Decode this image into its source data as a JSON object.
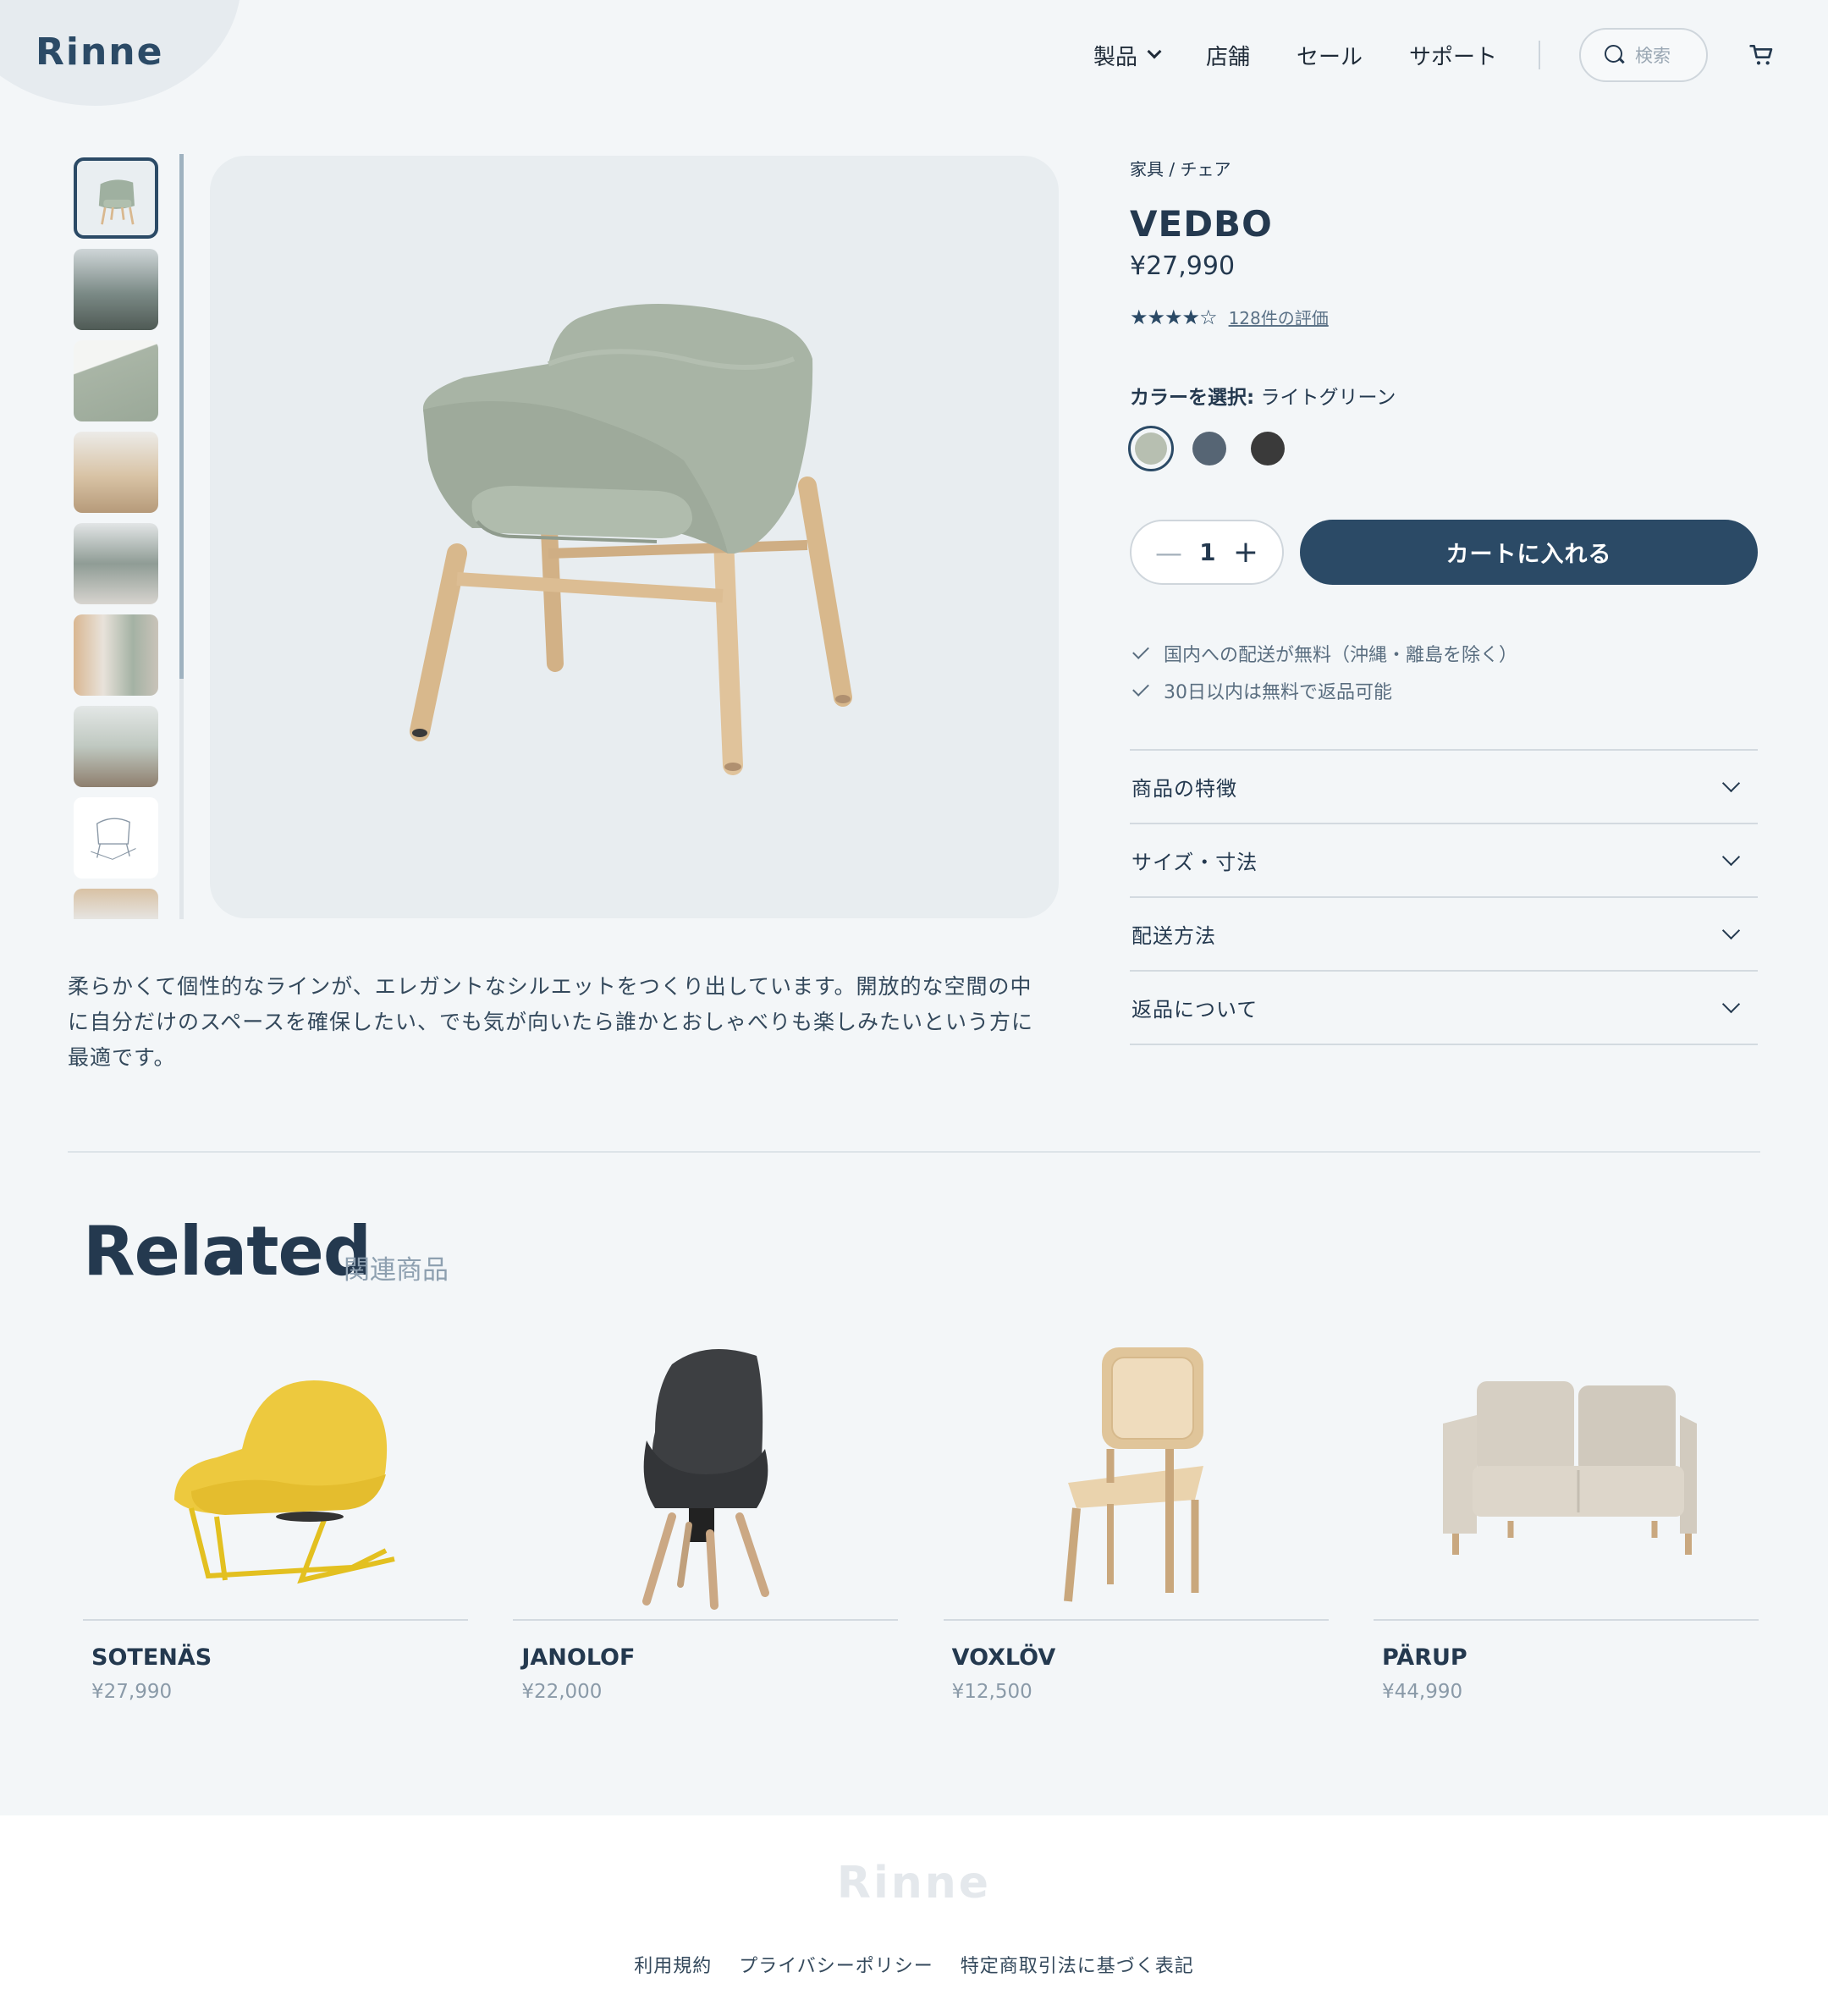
{
  "header": {
    "logo": "Rinne",
    "nav": [
      {
        "label": "製品",
        "has_dropdown": true
      },
      {
        "label": "店舗"
      },
      {
        "label": "セール"
      },
      {
        "label": "サポート"
      }
    ],
    "search_placeholder": "検索",
    "cart_icon": "cart-icon"
  },
  "gallery": {
    "thumb_count": 9,
    "active_index": 0
  },
  "product": {
    "breadcrumb": "家具 / チェア",
    "name": "VEDBO",
    "price": "¥27,990",
    "rating": 4,
    "rating_max": 5,
    "reviews": "128件の評価",
    "color_label": "カラーを選択:",
    "color_value": "ライトグリーン",
    "colors": [
      "#b7bfb1",
      "#566574",
      "#3a3a3a"
    ],
    "quantity": "1",
    "add_to_cart": "カートに入れる",
    "perks": [
      "国内への配送が無料（沖縄・離島を除く）",
      "30日以内は無料で返品可能"
    ],
    "accordion": [
      "商品の特徴",
      "サイズ・寸法",
      "配送方法",
      "返品について"
    ],
    "description": "柔らかくて個性的なラインが、エレガントなシルエットをつくり出しています。開放的な空間の中に自分だけのスペースを確保したい、でも気が向いたら誰かとおしゃべりも楽しみたいという方に最適です。"
  },
  "related": {
    "title": "Related",
    "subtitle": "関連商品",
    "items": [
      {
        "name": "SOTENÄS",
        "price": "¥27,990"
      },
      {
        "name": "JANOLOF",
        "price": "¥22,000"
      },
      {
        "name": "VOXLÖV",
        "price": "¥12,500"
      },
      {
        "name": "PÄRUP",
        "price": "¥44,990"
      }
    ]
  },
  "footer": {
    "logo": "Rinne",
    "links": [
      "利用規約",
      "プライバシーポリシー",
      "特定商取引法に基づく表記"
    ]
  },
  "colors": {
    "primary": "#2b4a66",
    "background": "#f3f6f8"
  }
}
